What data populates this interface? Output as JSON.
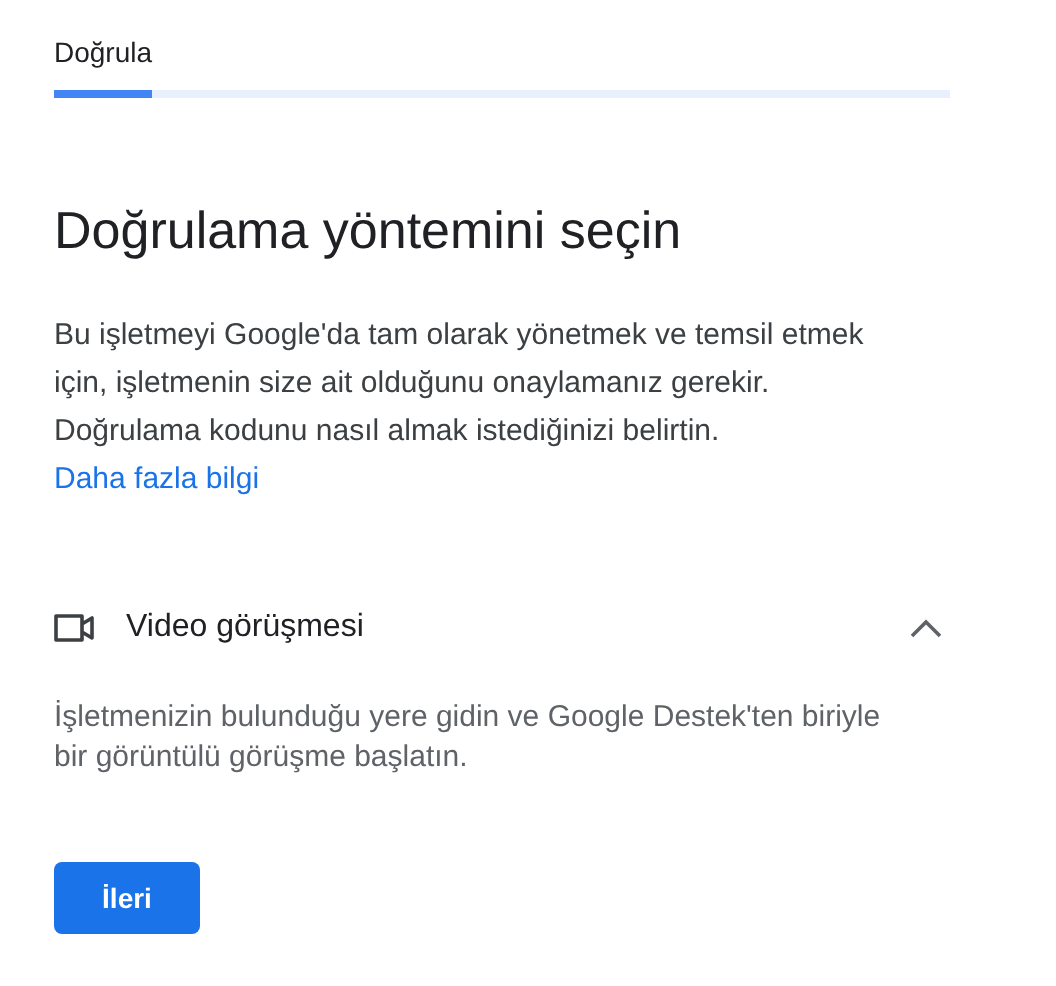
{
  "step": {
    "label": "Doğrula",
    "level": 0.11
  },
  "heading": "Doğrulama yöntemini seçin",
  "intro": "Bu işletmeyi Google'da tam olarak yönetmek ve temsil etmek için, işletmenin size ait olduğunu onaylamanız gerekir. Doğrulama kodunu nasıl almak istediğinizi belirtin.",
  "learn_more_link": "Daha fazla bilgi",
  "method": {
    "title": "Video görüşmesi",
    "expanded": true,
    "description": "İşletmenizin bulunduğu yere gidin ve Google Destek'ten biriyle bir görüntülü görüşme başlatın.",
    "button": "İleri"
  }
}
